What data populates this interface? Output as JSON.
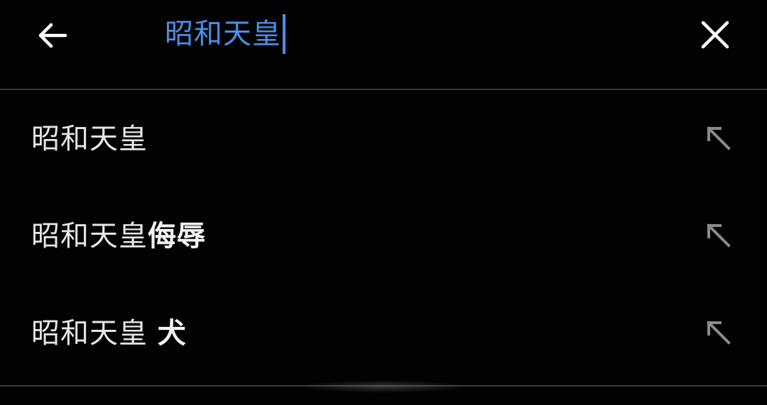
{
  "search": {
    "query": "昭和天皇"
  },
  "suggestions": [
    {
      "prefix": "昭和天皇",
      "suffix": ""
    },
    {
      "prefix": "昭和天皇",
      "suffix": "侮辱"
    },
    {
      "prefix": "昭和天皇 ",
      "suffix": "犬"
    }
  ],
  "icons": {
    "back": "arrow-left-icon",
    "clear": "close-icon",
    "fill": "arrow-up-left-icon"
  },
  "colors": {
    "background": "#020202",
    "accent": "#4a90e2",
    "text": "#e6e6e6",
    "divider": "#3a3a3a",
    "icon_muted": "#8a8a8a"
  }
}
